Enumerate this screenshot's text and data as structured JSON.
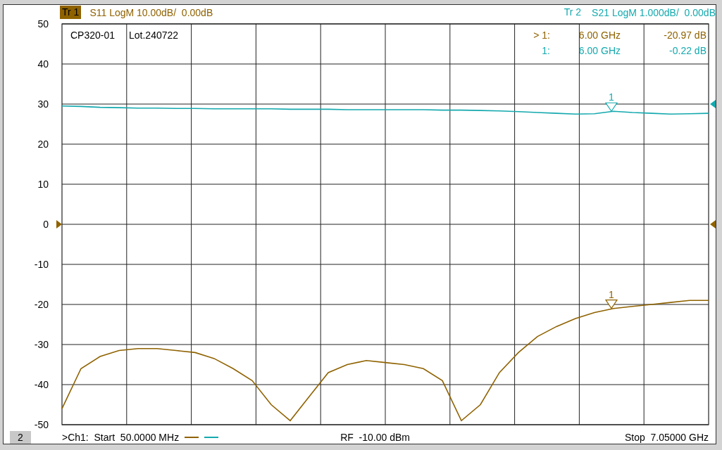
{
  "traces": [
    {
      "badge": "Tr 1",
      "label": "S11 LogM 10.00dB/  0.00dB",
      "selected": true,
      "color": "#8f6200"
    },
    {
      "badge": "Tr 2",
      "label": "S21 LogM 1.000dB/  0.00dB",
      "selected": false,
      "color": "#14a9ae"
    }
  ],
  "annotations": [
    "CP320-01",
    "Lot.240722"
  ],
  "marker_readouts": [
    {
      "prefix": "> 1:",
      "frequency": "6.00 GHz",
      "value": "-20.97 dB"
    },
    {
      "prefix": "1:",
      "frequency": "6.00 GHz",
      "value": "-0.22 dB"
    }
  ],
  "plot_markers": [
    {
      "label": "1",
      "color": "#14a9ae"
    },
    {
      "label": "1",
      "color": "#8f6200"
    }
  ],
  "chart_data": {
    "type": "line",
    "categories": [
      null,
      null,
      null,
      null,
      null,
      null,
      null,
      null,
      null,
      null,
      null,
      null,
      null,
      null,
      null,
      null,
      null,
      null,
      null,
      null,
      null,
      null,
      null,
      null,
      null,
      null,
      null,
      null,
      null,
      null,
      null,
      null,
      null,
      null,
      null
    ],
    "series": [
      {
        "color": "#8f6200",
        "values": [
          -46,
          -36,
          -33,
          -31.5,
          -31,
          -31,
          -31.5,
          -32,
          -33.5,
          -36,
          -39,
          -45,
          -49,
          -43,
          -37,
          -35,
          -34,
          -34.5,
          -35,
          -36,
          -39,
          -49,
          -45,
          -37,
          -32,
          -28,
          -25.5,
          -23.5,
          -22,
          -21,
          -20.5,
          -20,
          -19.5,
          -19,
          -19
        ]
      },
      {
        "color": "#14a9ae",
        "values": [
          29.5,
          29.4,
          29.2,
          29.1,
          29,
          29,
          28.9,
          28.9,
          28.8,
          28.8,
          28.8,
          28.8,
          28.7,
          28.7,
          28.7,
          28.6,
          28.6,
          28.6,
          28.6,
          28.6,
          28.5,
          28.5,
          28.4,
          28.3,
          28.1,
          27.9,
          27.7,
          27.5,
          27.6,
          28.2,
          27.9,
          27.7,
          27.5,
          27.6,
          27.7
        ]
      }
    ],
    "grid": true,
    "ylim": [
      -50,
      50
    ],
    "yticks": [
      50,
      40,
      30,
      20,
      10,
      0,
      -10,
      -20,
      -30,
      -40,
      -50
    ]
  },
  "footer": {
    "channel_badge": "2",
    "start": ">Ch1:  Start  50.0000 MHz",
    "power": "RF  -10.00 dBm",
    "stop": "Stop  7.05000 GHz"
  }
}
